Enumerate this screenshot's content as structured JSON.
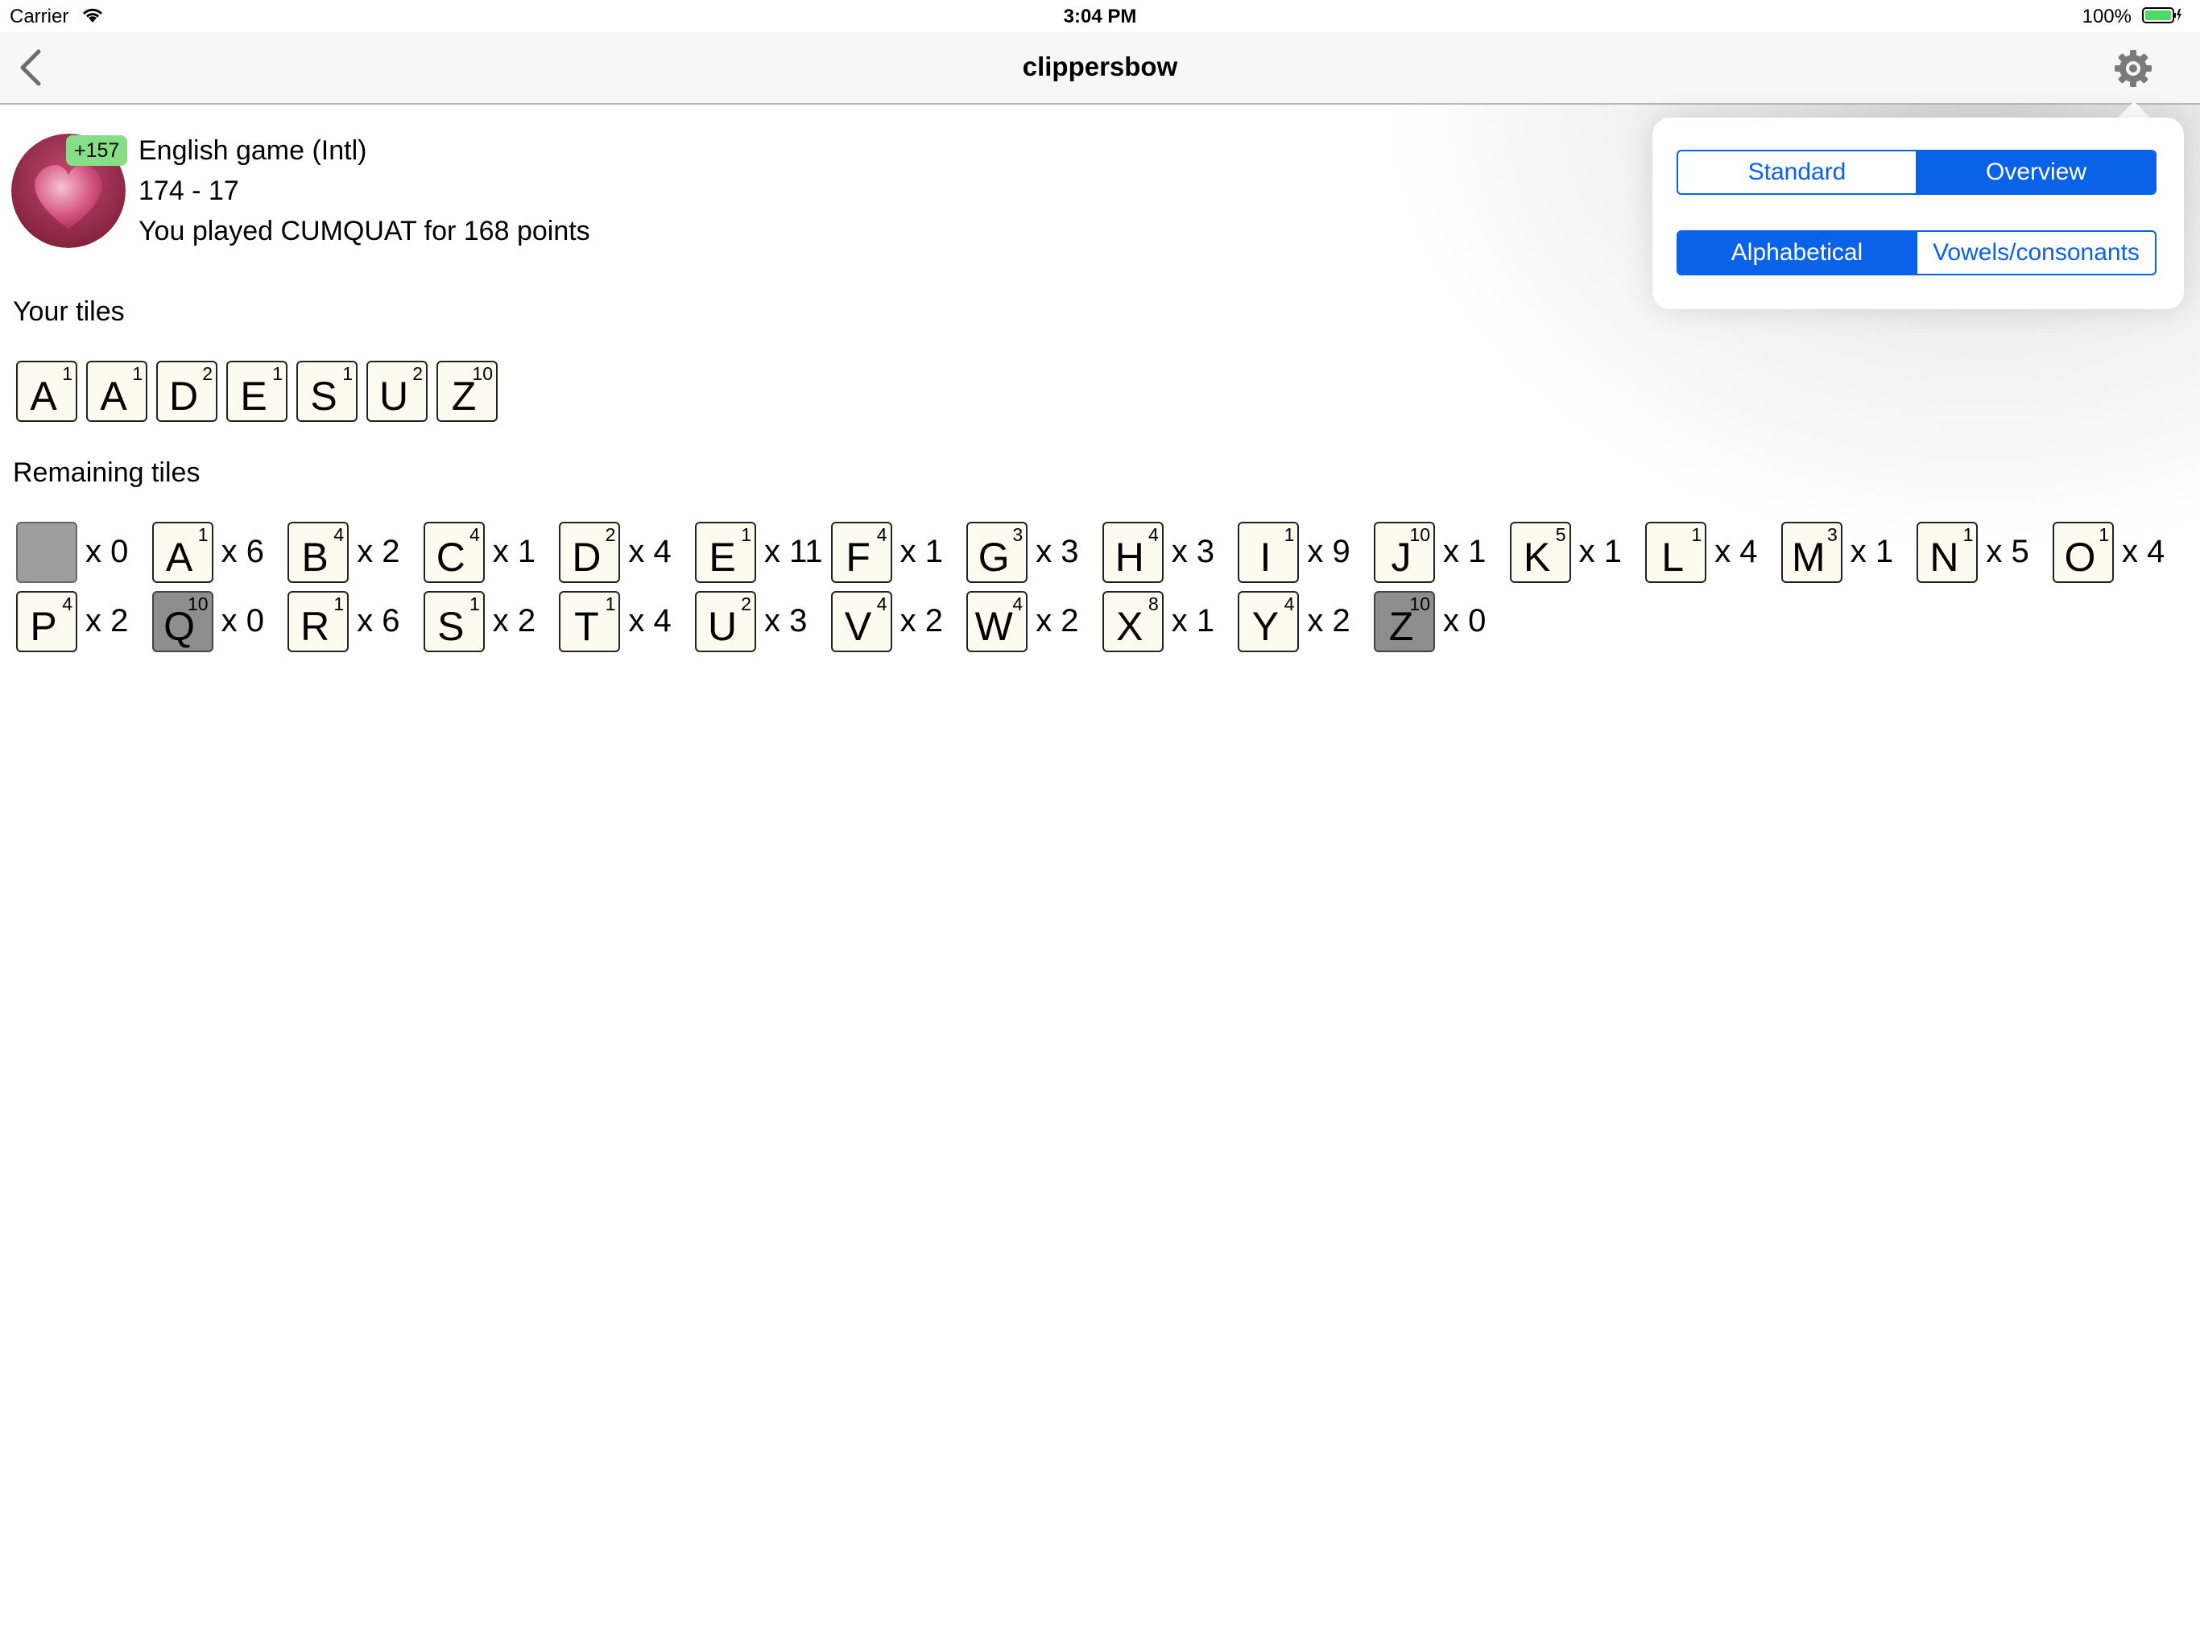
{
  "status": {
    "carrier": "Carrier",
    "time": "3:04 PM",
    "battery_pct": "100%"
  },
  "nav": {
    "title": "clippersbow",
    "back_icon": "chevron-left-icon",
    "gear_icon": "gear-icon"
  },
  "game": {
    "score_delta": "+157",
    "title": "English game (Intl)",
    "score": "174 - 17",
    "last_move": "You played CUMQUAT for 168 points"
  },
  "your_tiles": {
    "label": "Your tiles",
    "tiles": [
      {
        "letter": "A",
        "points": "1"
      },
      {
        "letter": "A",
        "points": "1"
      },
      {
        "letter": "D",
        "points": "2"
      },
      {
        "letter": "E",
        "points": "1"
      },
      {
        "letter": "S",
        "points": "1"
      },
      {
        "letter": "U",
        "points": "2"
      },
      {
        "letter": "Z",
        "points": "10"
      }
    ]
  },
  "remaining": {
    "label": "Remaining tiles",
    "tiles": [
      {
        "letter": "",
        "points": "",
        "count": "x 0",
        "blank": true
      },
      {
        "letter": "A",
        "points": "1",
        "count": "x 6"
      },
      {
        "letter": "B",
        "points": "4",
        "count": "x 2"
      },
      {
        "letter": "C",
        "points": "4",
        "count": "x 1"
      },
      {
        "letter": "D",
        "points": "2",
        "count": "x 4"
      },
      {
        "letter": "E",
        "points": "1",
        "count": "x 11"
      },
      {
        "letter": "F",
        "points": "4",
        "count": "x 1"
      },
      {
        "letter": "G",
        "points": "3",
        "count": "x 3"
      },
      {
        "letter": "H",
        "points": "4",
        "count": "x 3"
      },
      {
        "letter": "I",
        "points": "1",
        "count": "x 9"
      },
      {
        "letter": "J",
        "points": "10",
        "count": "x 1"
      },
      {
        "letter": "K",
        "points": "5",
        "count": "x 1"
      },
      {
        "letter": "L",
        "points": "1",
        "count": "x 4"
      },
      {
        "letter": "M",
        "points": "3",
        "count": "x 1"
      },
      {
        "letter": "N",
        "points": "1",
        "count": "x 5"
      },
      {
        "letter": "O",
        "points": "1",
        "count": "x 4"
      },
      {
        "letter": "P",
        "points": "4",
        "count": "x 2"
      },
      {
        "letter": "Q",
        "points": "10",
        "count": "x 0",
        "empty": true
      },
      {
        "letter": "R",
        "points": "1",
        "count": "x 6"
      },
      {
        "letter": "S",
        "points": "1",
        "count": "x 2"
      },
      {
        "letter": "T",
        "points": "1",
        "count": "x 4"
      },
      {
        "letter": "U",
        "points": "2",
        "count": "x 3"
      },
      {
        "letter": "V",
        "points": "4",
        "count": "x 2"
      },
      {
        "letter": "W",
        "points": "4",
        "count": "x 2"
      },
      {
        "letter": "X",
        "points": "8",
        "count": "x 1"
      },
      {
        "letter": "Y",
        "points": "4",
        "count": "x 2"
      },
      {
        "letter": "Z",
        "points": "10",
        "count": "x 0",
        "empty": true
      }
    ]
  },
  "settings_popover": {
    "view_segment": {
      "options": [
        "Standard",
        "Overview"
      ],
      "selected": "Overview"
    },
    "sort_segment": {
      "options": [
        "Alphabetical",
        "Vowels/consonants"
      ],
      "selected": "Alphabetical"
    }
  },
  "colors": {
    "accent": "#0a62e8",
    "tile_bg": "#fbfbef",
    "badge_bg": "#86df86",
    "empty_tile": "#8e8e8e"
  }
}
